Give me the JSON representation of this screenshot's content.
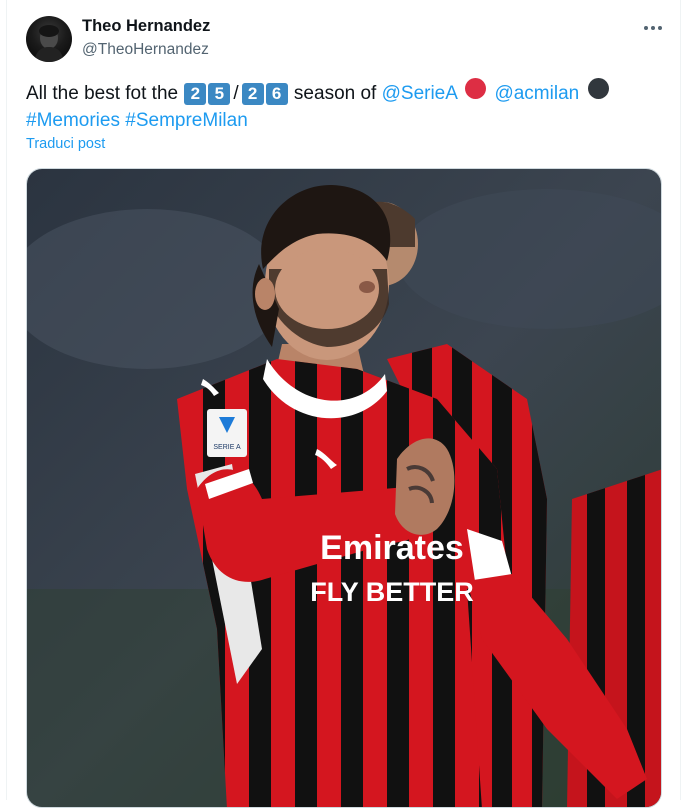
{
  "author": {
    "display_name": "Theo Hernandez",
    "handle": "@TheoHernandez",
    "avatar_icon": "profile-photo"
  },
  "more_icon": "more-horizontal-icon",
  "tweet": {
    "text_start": "All the best fot the ",
    "keycap_2a": "2",
    "keycap_5": "5",
    "slash": "/",
    "keycap_2b": "2",
    "keycap_6": "6",
    "text_mid": " season of ",
    "mention_seriea": "@SerieA",
    "red_circle_color": "#dd2e44",
    "mention_acmilan": "@acmilan",
    "black_circle_color": "#31373d",
    "hashtag_memories": "#Memories",
    "hashtag_sempremilan": "#SempreMilan"
  },
  "translate_label": "Traduci post",
  "media": {
    "sponsor_line1": "Emirates",
    "sponsor_line2": "FLY BETTER",
    "patch_text": "SERIE A",
    "jersey_colors": {
      "red": "#d4161f",
      "black": "#111111"
    }
  },
  "colors": {
    "link": "#1d9bf0",
    "secondary": "#536471",
    "keycap": "#3b88c3"
  }
}
